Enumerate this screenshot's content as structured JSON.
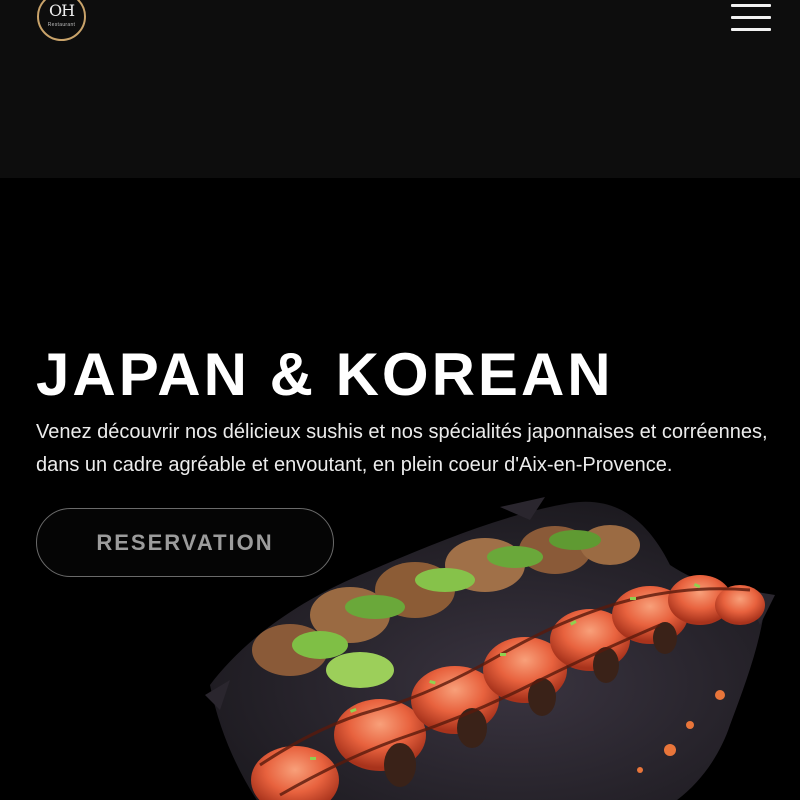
{
  "header": {
    "logo": {
      "main_text": "OH",
      "sub_text": "Restaurant"
    },
    "menu_icon": "hamburger-menu-icon",
    "background_color": "#0d0d0d"
  },
  "hero": {
    "title": "JAPAN & KOREAN",
    "description": "Venez découvrir nos délicieux sushis et nos spécialités japonnaises et corréennes, dans un cadre agréable et envoutant, en plein coeur d'Aix-en-Provence.",
    "cta_label": "RESERVATION",
    "image": "sushi-rolls-platter",
    "background_color": "#000000"
  },
  "colors": {
    "accent_gold": "#c9a36a",
    "text_white": "#ffffff",
    "button_border": "#6a6a6a",
    "button_text": "#9c9c9c"
  }
}
